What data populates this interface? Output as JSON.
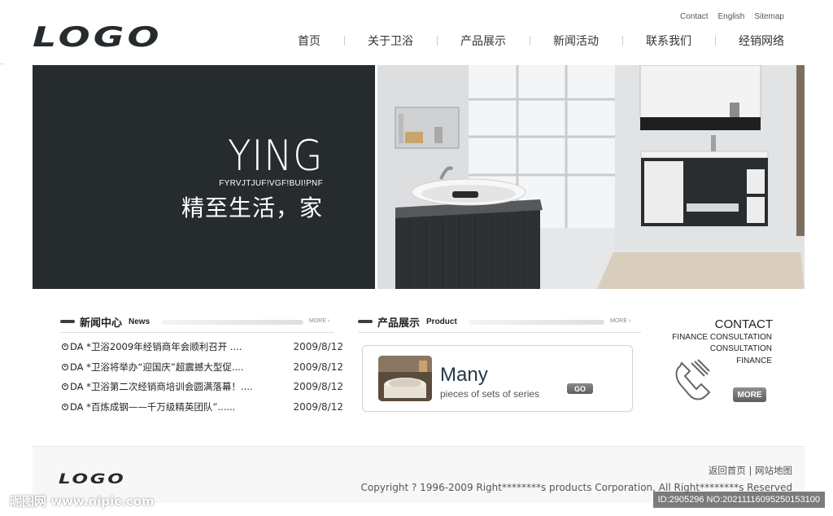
{
  "header": {
    "logo_text": "LOGO",
    "utility_links": [
      "Contact",
      "English",
      "Sitemap"
    ],
    "nav": [
      "首页",
      "关于卫浴",
      "产品展示",
      "新闻活动",
      "联系我们",
      "经销网络"
    ]
  },
  "banner": {
    "title": "YING",
    "subtitle": "FYRVJTJUF!VGF!BUI!PNF",
    "slogan": "精至生活，家"
  },
  "news": {
    "heading_cn": "新闻中心",
    "heading_en": "News",
    "more_label": "MORE ›",
    "items": [
      {
        "title": "DA *卫浴2009年经销商年会顺利召开 ....",
        "date": "2009/8/12"
      },
      {
        "title": "DA *卫浴将举办“迎国庆”超震撼大型促....",
        "date": "2009/8/12"
      },
      {
        "title": "DA *卫浴第二次经销商培训会圆满落幕！....",
        "date": "2009/8/12"
      },
      {
        "title": "DA *百炼成钢——千万级精英团队”......",
        "date": "2009/8/12"
      }
    ]
  },
  "product": {
    "heading_cn": "产品展示",
    "heading_en": "Product",
    "more_label": "MORE ›",
    "card_title": "Many",
    "card_subtitle": "pieces of sets of series",
    "go_label": "GO"
  },
  "contact": {
    "title": "CONTACT",
    "lines": [
      "FINANCE CONSULTATION",
      "CONSULTATION",
      "FINANCE"
    ],
    "more_label": "MORE"
  },
  "footer": {
    "logo_text": "LOGO",
    "link_home": "返回首页",
    "link_sep": "|",
    "link_map": "网站地图",
    "copyright": "Copyright ? 1996-2009 Right********s products Corporation, All Right********s Reserved"
  },
  "watermark": {
    "left": "昵图网 www.nipic.com",
    "right": "ID:2905296 NO:20211116095250153100"
  },
  "colors": {
    "dark_panel": "#262b2d",
    "accent_text": "#233846"
  }
}
